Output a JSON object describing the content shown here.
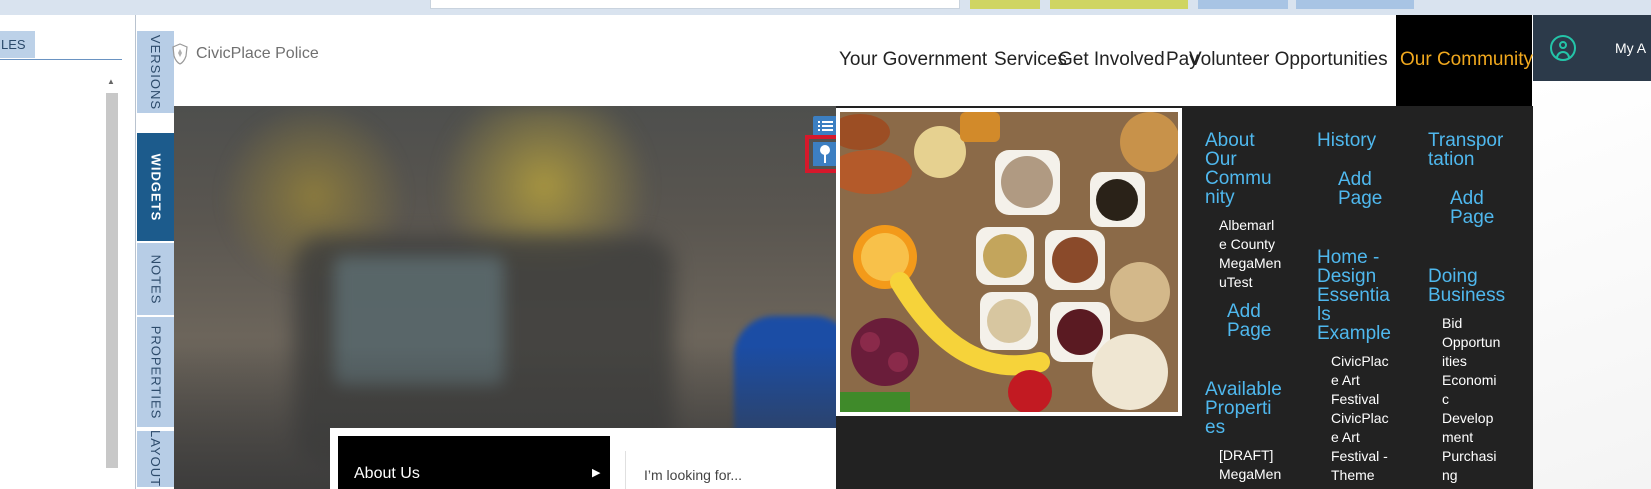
{
  "left_panel": {
    "tab_label": "LES"
  },
  "rail_tabs": [
    "VERSIONS",
    "WIDGETS",
    "NOTES",
    "PROPERTIES",
    "LAYOUT"
  ],
  "header": {
    "site_name": "CivicPlace Police",
    "nav": [
      "Your Government",
      "Services",
      "Get Involved",
      "Pay",
      "Volunteer Opportunities",
      "Our Community"
    ],
    "user_label": "My A"
  },
  "hero": {
    "about_label": "About Us",
    "search_placeholder": "I’m looking for..."
  },
  "mega_menu": {
    "col1": {
      "heading1_lines": [
        "About",
        "Our",
        "Commu",
        "nity"
      ],
      "item1_lines": [
        "Albemarl",
        "e County",
        "MegaMen",
        "uTest"
      ],
      "add1_lines": [
        "Add",
        "Page"
      ],
      "heading2_lines": [
        "Available",
        "Properti",
        "es"
      ],
      "item2_lines": [
        "[DRAFT]",
        "MegaMen"
      ]
    },
    "col2": {
      "heading1": "History",
      "add1_lines": [
        "Add",
        "Page"
      ],
      "heading2_lines": [
        "Home -",
        "Design",
        "Essentia",
        "ls",
        "Example"
      ],
      "item2_lines": [
        "CivicPlac",
        "e Art",
        "Festival",
        "CivicPlac",
        "e Art",
        "Festival -",
        "Theme"
      ]
    },
    "col3": {
      "heading1_lines": [
        "Transpor",
        "tation"
      ],
      "add1_lines": [
        "Add",
        "Page"
      ],
      "heading2_lines": [
        "Doing",
        "Business"
      ],
      "item2_lines": [
        "Bid",
        "Opportun",
        "ities",
        "Economi",
        "c",
        "Develop",
        "ment",
        "Purchasi",
        "ng"
      ]
    }
  },
  "colors": {
    "accent_community": "#f0a81e",
    "menu_link": "#4fb8ee",
    "widgets_tab": "#1c5b8c",
    "highlight": "#d6182b"
  }
}
